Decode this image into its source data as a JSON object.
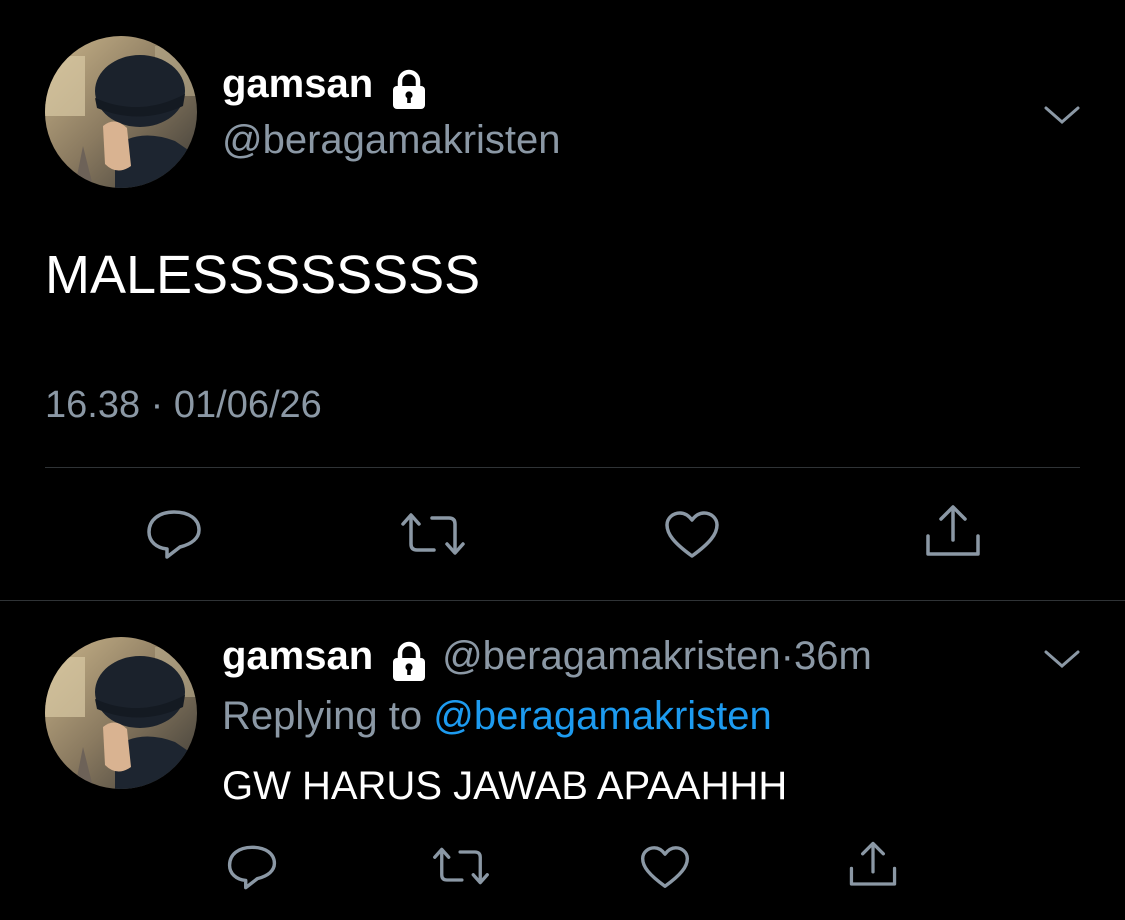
{
  "main_tweet": {
    "display_name": "gamsan",
    "handle": "@beragamakristen",
    "text": "MALESSSSSSSS",
    "time": "16.38",
    "separator": "·",
    "date": "01/06/26",
    "icons": [
      "lock-icon",
      "chevron-down-icon",
      "reply-icon",
      "retweet-icon",
      "like-icon",
      "share-icon"
    ]
  },
  "reply_tweet": {
    "display_name": "gamsan",
    "handle": "@beragamakristen",
    "dot": "·",
    "age": "36m",
    "replying_label": "Replying to",
    "replying_handle": "@beragamakristen",
    "text": "GW HARUS JAWAB APAAHHH"
  },
  "colors": {
    "background": "#000000",
    "text_primary": "#ffffff",
    "text_secondary": "#8b98a5",
    "link": "#1d9bf0",
    "divider": "#2f3336"
  }
}
